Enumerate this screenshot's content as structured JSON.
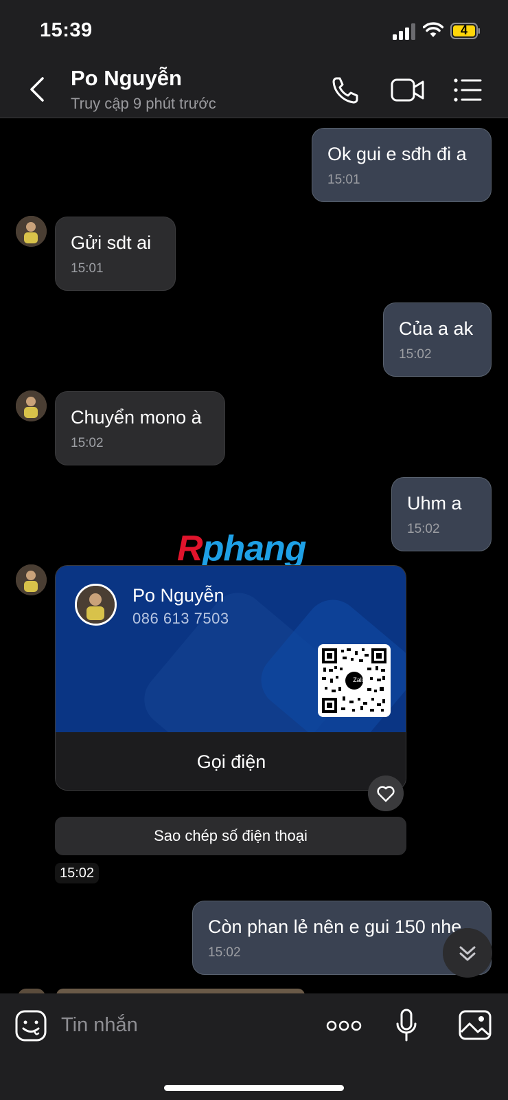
{
  "status_bar": {
    "time": "15:39",
    "battery": "4"
  },
  "header": {
    "contact_name": "Po Nguyễn",
    "last_seen": "Truy cập 9 phút trước"
  },
  "messages": [
    {
      "direction": "out",
      "text": "Ok gui e sđh đi a",
      "time": "15:01"
    },
    {
      "direction": "in",
      "text": "Gửi sdt ai",
      "time": "15:01"
    },
    {
      "direction": "out",
      "text": "Của a ak",
      "time": "15:02"
    },
    {
      "direction": "in",
      "text": "Chuyển mono à",
      "time": "15:02"
    },
    {
      "direction": "out",
      "text": "Uhm a",
      "time": "15:02"
    },
    {
      "direction": "out",
      "text": "Còn phan lẻ nên e gui 150 nhe",
      "time": "15:02"
    }
  ],
  "contact_card": {
    "name": "Po Nguyễn",
    "phone": "086 613 7503",
    "qr_badge": "Zalo",
    "call_label": "Gọi điện",
    "copy_label": "Sao chép số điện thoại",
    "time": "15:02"
  },
  "watermark": {
    "part1": "R",
    "part2": "phang",
    "color1": "#e0142c",
    "color2": "#1ea0e6"
  },
  "input": {
    "placeholder": "Tin nhắn"
  },
  "colors": {
    "outgoing_bubble": "#3a4252",
    "incoming_bubble": "#2c2c2e",
    "card_blue": "#0a3584",
    "bar_bg": "#1f1f21"
  }
}
